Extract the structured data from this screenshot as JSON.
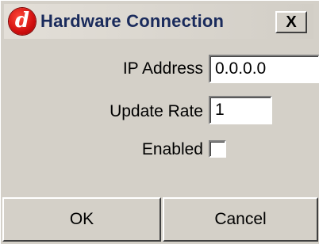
{
  "window": {
    "title": "Hardware Connection",
    "close_label": "X",
    "icon": "app-logo-d-icon"
  },
  "form": {
    "ip_address": {
      "label": "IP Address",
      "value": "0.0.0.0"
    },
    "update_rate": {
      "label": "Update Rate",
      "value": "1"
    },
    "enabled": {
      "label": "Enabled",
      "checked": false
    }
  },
  "buttons": {
    "ok_label": "OK",
    "cancel_label": "Cancel"
  }
}
